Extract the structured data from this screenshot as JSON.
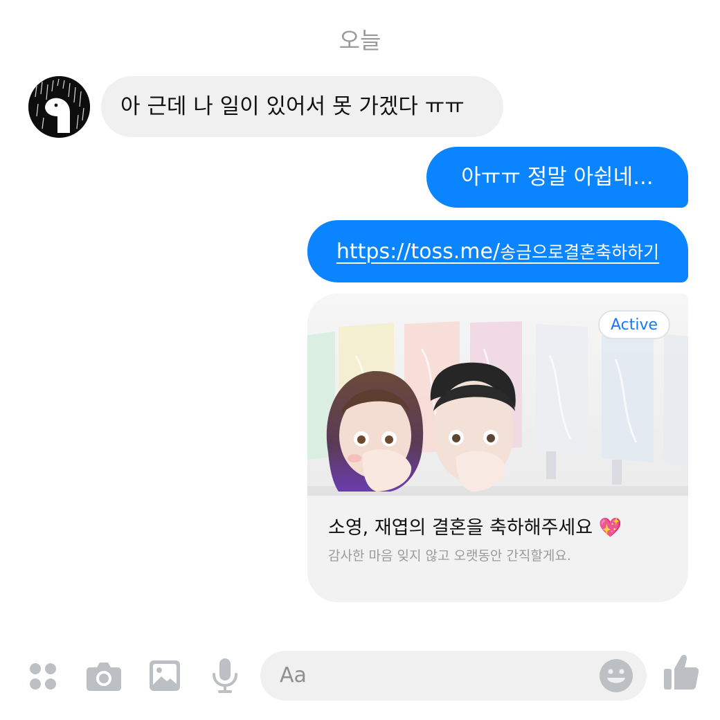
{
  "conversation": {
    "date_separator": "오늘",
    "messages": [
      {
        "direction": "incoming",
        "text": "아 근데 나 일이 있어서 못 가겠다 ㅠㅠ"
      },
      {
        "direction": "outgoing",
        "text": "아ㅠㅠ 정말 아쉽네..."
      },
      {
        "direction": "outgoing",
        "link_host": "https://toss.me/",
        "link_path": "송금으로결혼축하하기"
      }
    ]
  },
  "link_card": {
    "badge": "Active",
    "title": "소영, 재엽의 결혼을 축하해주세요",
    "title_emoji": "💖",
    "subtitle": "감사한 마음 잊지 않고 오랫동안 간직할게요."
  },
  "composer": {
    "placeholder": "Aa",
    "icons": [
      "apps-icon",
      "camera-icon",
      "image-icon",
      "microphone-icon",
      "emoji-icon",
      "thumbs-up-icon"
    ]
  },
  "colors": {
    "outgoing_bubble": "#0a84ff",
    "incoming_bubble": "#f0f0f0",
    "icon_gray": "#bcc0c4",
    "badge_text": "#1877f2"
  }
}
